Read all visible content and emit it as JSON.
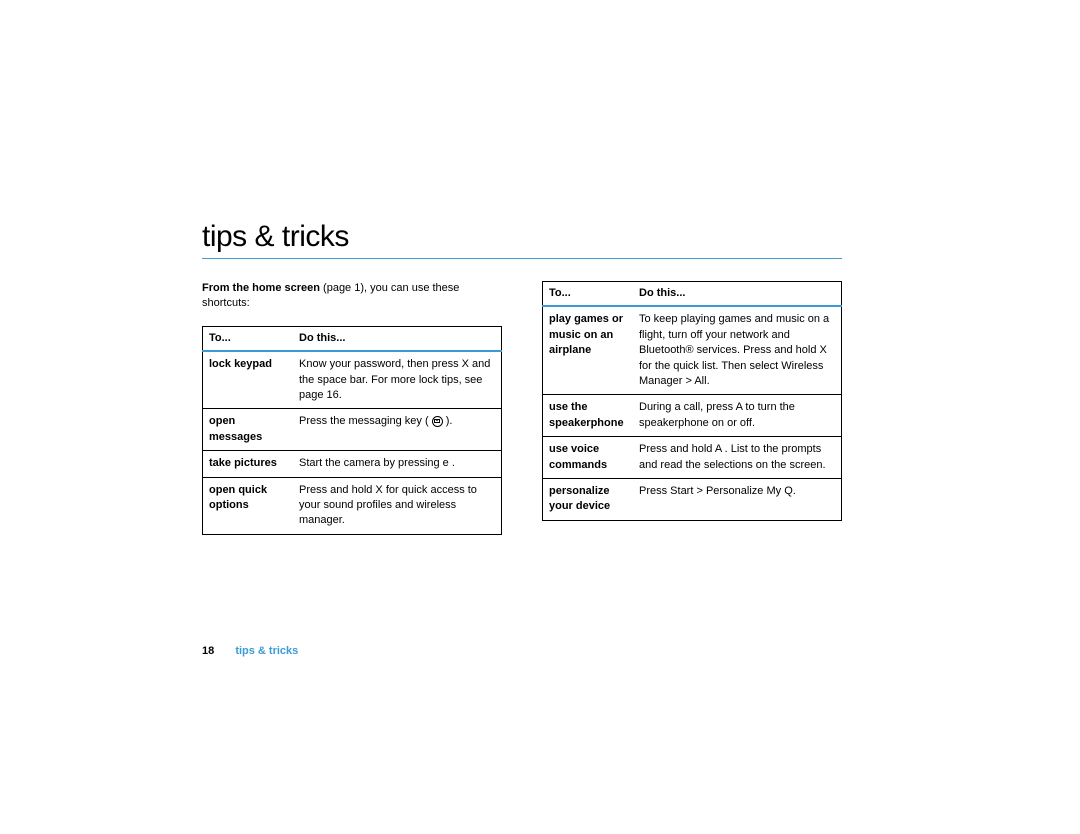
{
  "title": "tips & tricks",
  "intro_bold": "From the home screen",
  "intro_rest": " (page 1), you can use these shortcuts:",
  "th_to": "To...",
  "th_do": "Do this...",
  "left_rows": [
    {
      "to": "lock keypad",
      "do": "Know your password, then press X and the space bar. For more lock tips, see page 16."
    },
    {
      "to": "open messages",
      "do": "Press the messaging key ( __MSGICON__ )."
    },
    {
      "to": "take pictures",
      "do": "Start the camera by pressing e ."
    },
    {
      "to": "open quick options",
      "do": "Press and hold X for quick access to your sound profiles and wireless manager."
    }
  ],
  "right_rows": [
    {
      "to": "play games or music on an airplane",
      "do": "To keep playing games and music on a flight, turn off your network and Bluetooth® services. Press and hold X for the quick list. Then select Wireless Manager > All."
    },
    {
      "to": "use the speakerphone",
      "do": "During a call, press A to turn the speakerphone on or off."
    },
    {
      "to": "use voice commands",
      "do": "Press and hold A . List to the prompts and read the selections on the screen."
    },
    {
      "to": "personalize your device",
      "do": "Press Start > Personalize My Q."
    }
  ],
  "footer_page": "18",
  "footer_section": "tips & tricks"
}
